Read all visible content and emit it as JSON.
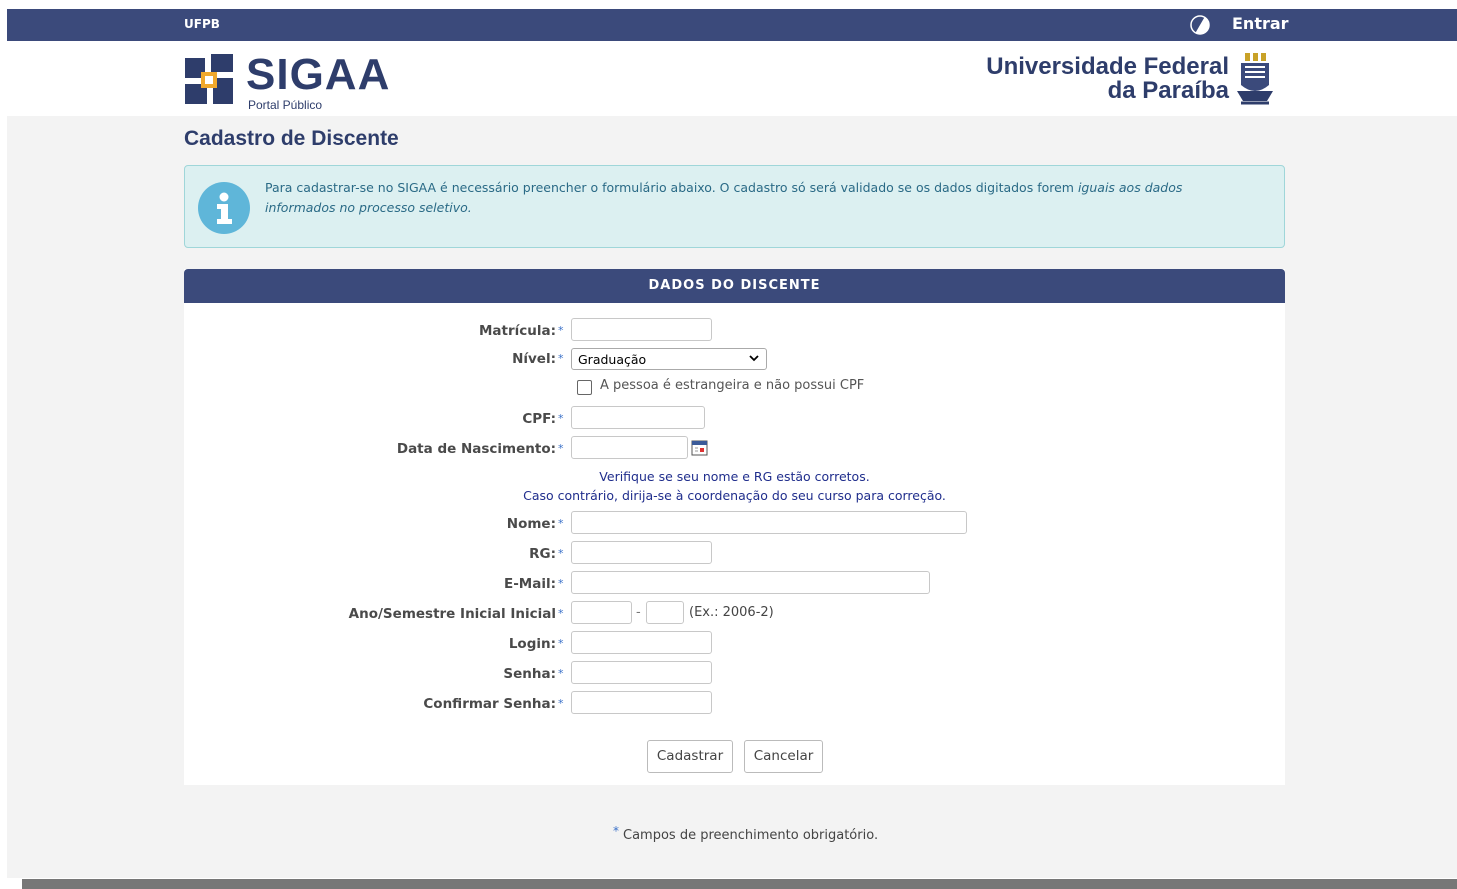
{
  "topbar": {
    "brand": "UFPB",
    "login_label": "Entrar"
  },
  "header": {
    "logo_title": "SIGAA",
    "logo_subtitle": "Portal Público",
    "university_line1": "Universidade Federal",
    "university_line2": "da Paraíba"
  },
  "page": {
    "title": "Cadastro de Discente"
  },
  "info": {
    "text_plain": "Para cadastrar-se no SIGAA é necessário preencher o formulário abaixo. O cadastro só será validado se os dados digitados forem ",
    "text_italic": "iguais aos dados informados no processo seletivo."
  },
  "form": {
    "section_title": "DADOS DO DISCENTE",
    "required_marker": "*",
    "fields": {
      "matricula": {
        "label": "Matrícula:",
        "value": ""
      },
      "nivel": {
        "label": "Nível:",
        "value": "Graduação"
      },
      "estrangeiro": {
        "label": "A pessoa é estrangeira e não possui CPF",
        "checked": false
      },
      "cpf": {
        "label": "CPF:",
        "value": ""
      },
      "nascimento": {
        "label": "Data de Nascimento:",
        "value": ""
      },
      "nome": {
        "label": "Nome:",
        "value": ""
      },
      "rg": {
        "label": "RG:",
        "value": ""
      },
      "email": {
        "label": "E-Mail:",
        "value": ""
      },
      "ano_semestre": {
        "label": "Ano/Semestre Inicial Inicial",
        "separator": "-",
        "hint": "(Ex.: 2006-2)"
      },
      "login": {
        "label": "Login:",
        "value": ""
      },
      "senha": {
        "label": "Senha:",
        "value": ""
      },
      "confirmar_senha": {
        "label": "Confirmar Senha:",
        "value": ""
      }
    },
    "note_line1": "Verifique se seu nome e RG estão corretos.",
    "note_line2": "Caso contrário, dirija-se à coordenação do seu curso para correção.",
    "buttons": {
      "submit": "Cadastrar",
      "cancel": "Cancelar"
    }
  },
  "footer": {
    "required_note": "Campos de preenchimento obrigatório."
  },
  "colors": {
    "primary": "#3b4a7b",
    "accent_star": "#3a70c8",
    "info_bg": "#dcf0f1",
    "info_text": "#2a6a86",
    "note_text": "#1f2d8c"
  },
  "icons": [
    "contrast-icon",
    "info-icon",
    "calendar-icon",
    "chevron-down-icon",
    "sigaa-logo-icon",
    "university-crest-icon"
  ]
}
